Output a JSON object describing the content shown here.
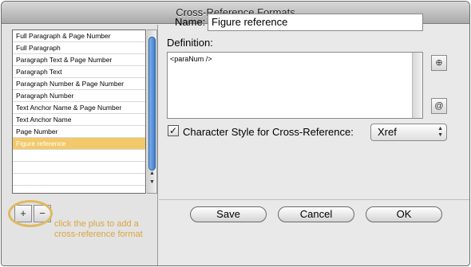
{
  "window": {
    "title": "Cross-Reference Formats"
  },
  "format_list": {
    "items": [
      "Full Paragraph & Page Number",
      "Full Paragraph",
      "Paragraph Text & Page Number",
      "Paragraph Text",
      "Paragraph Number & Page Number",
      "Paragraph Number",
      "Text Anchor Name & Page Number",
      "Text Anchor Name",
      "Page Number",
      "Figure reference"
    ],
    "selected_index": 9,
    "add_label": "+",
    "remove_label": "−"
  },
  "callout": {
    "text": "click the plus to add a cross-reference format"
  },
  "name": {
    "label": "Name:",
    "value": "Figure reference"
  },
  "definition": {
    "label": "Definition:",
    "value": "<paraNum />"
  },
  "definition_buttons": {
    "insert_building_block": "⊕",
    "insert_special_char": "@"
  },
  "character_style": {
    "checked": true,
    "check_glyph": "✓",
    "label": "Character Style for Cross-Reference:",
    "selected": "Xref"
  },
  "buttons": {
    "save": "Save",
    "cancel": "Cancel",
    "ok": "OK"
  },
  "colors": {
    "selection": "#f2c96a",
    "callout": "#e0b860",
    "scroll_thumb": "#3f7fd0"
  }
}
